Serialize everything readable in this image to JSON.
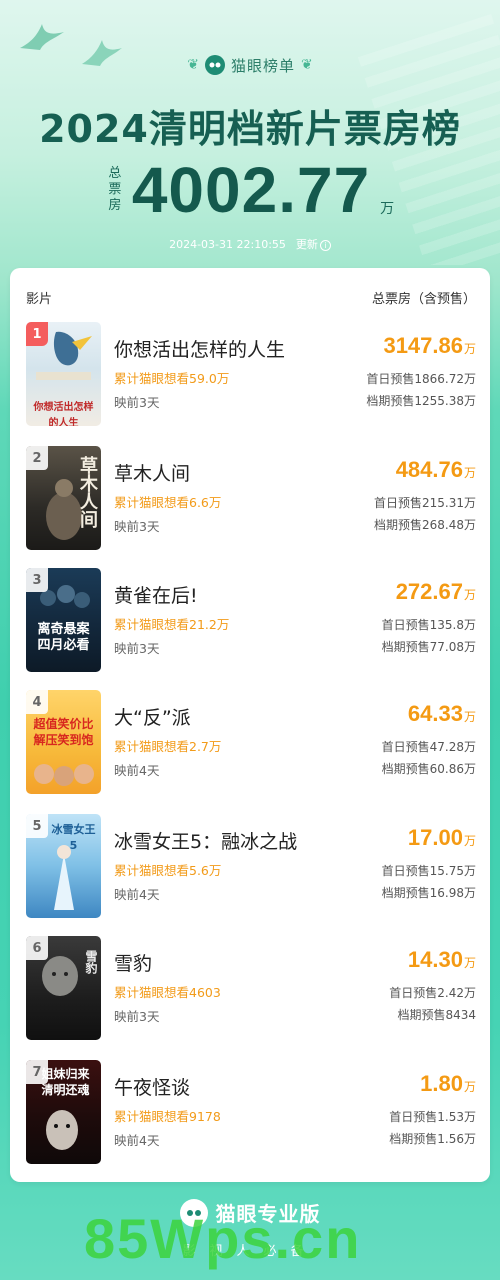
{
  "header": {
    "brand": "猫眼榜单",
    "title": "2024清明档新片票房榜",
    "total_label": "总票房",
    "total_value": "4002.77",
    "total_unit": "万",
    "update_time": "2024-03-31  22:10:55",
    "update_label": "更新"
  },
  "table": {
    "col_film": "影片",
    "col_box": "总票房（含预售）"
  },
  "films": [
    {
      "rank": "1",
      "title": "你想活出怎样的人生",
      "box": "3147.86",
      "unit": "万",
      "want": "累计猫眼想看59.0万",
      "days": "映前3天",
      "pre1": "首日预售1866.72万",
      "pre2": "档期预售1255.38万",
      "poster_text": "你想活出怎样的人生"
    },
    {
      "rank": "2",
      "title": "草木人间",
      "box": "484.76",
      "unit": "万",
      "want": "累计猫眼想看6.6万",
      "days": "映前3天",
      "pre1": "首日预售215.31万",
      "pre2": "档期预售268.48万",
      "poster_text": "草木人间"
    },
    {
      "rank": "3",
      "title": "黄雀在后!",
      "box": "272.67",
      "unit": "万",
      "want": "累计猫眼想看21.2万",
      "days": "映前3天",
      "pre1": "首日预售135.8万",
      "pre2": "档期预售77.08万",
      "poster_text": "离奇悬案 四月必看"
    },
    {
      "rank": "4",
      "title": "大“反”派",
      "box": "64.33",
      "unit": "万",
      "want": "累计猫眼想看2.7万",
      "days": "映前4天",
      "pre1": "首日预售47.28万",
      "pre2": "档期预售60.86万",
      "poster_text": "超值笑价比 解压笑到饱"
    },
    {
      "rank": "5",
      "title": "冰雪女王5：融冰之战",
      "box": "17.00",
      "unit": "万",
      "want": "累计猫眼想看5.6万",
      "days": "映前4天",
      "pre1": "首日预售15.75万",
      "pre2": "档期预售16.98万",
      "poster_text": "冰雪女王5"
    },
    {
      "rank": "6",
      "title": "雪豹",
      "box": "14.30",
      "unit": "万",
      "want": "累计猫眼想看4603",
      "days": "映前3天",
      "pre1": "首日预售2.42万",
      "pre2": "档期预售8434",
      "poster_text": "雪豹"
    },
    {
      "rank": "7",
      "title": "午夜怪谈",
      "box": "1.80",
      "unit": "万",
      "want": "累计猫眼想看9178",
      "days": "映前4天",
      "pre1": "首日预售1.53万",
      "pre2": "档期预售1.56万",
      "poster_text": "姐妹归来 清明还魂"
    }
  ],
  "footer": {
    "brand": "猫眼专业版",
    "slogan": "影视人必备",
    "watermark": "85Wps.cn"
  },
  "colors": {
    "accent_orange": "#f49a13",
    "title_green": "#165f52",
    "rank1_red": "#f45d5d"
  }
}
